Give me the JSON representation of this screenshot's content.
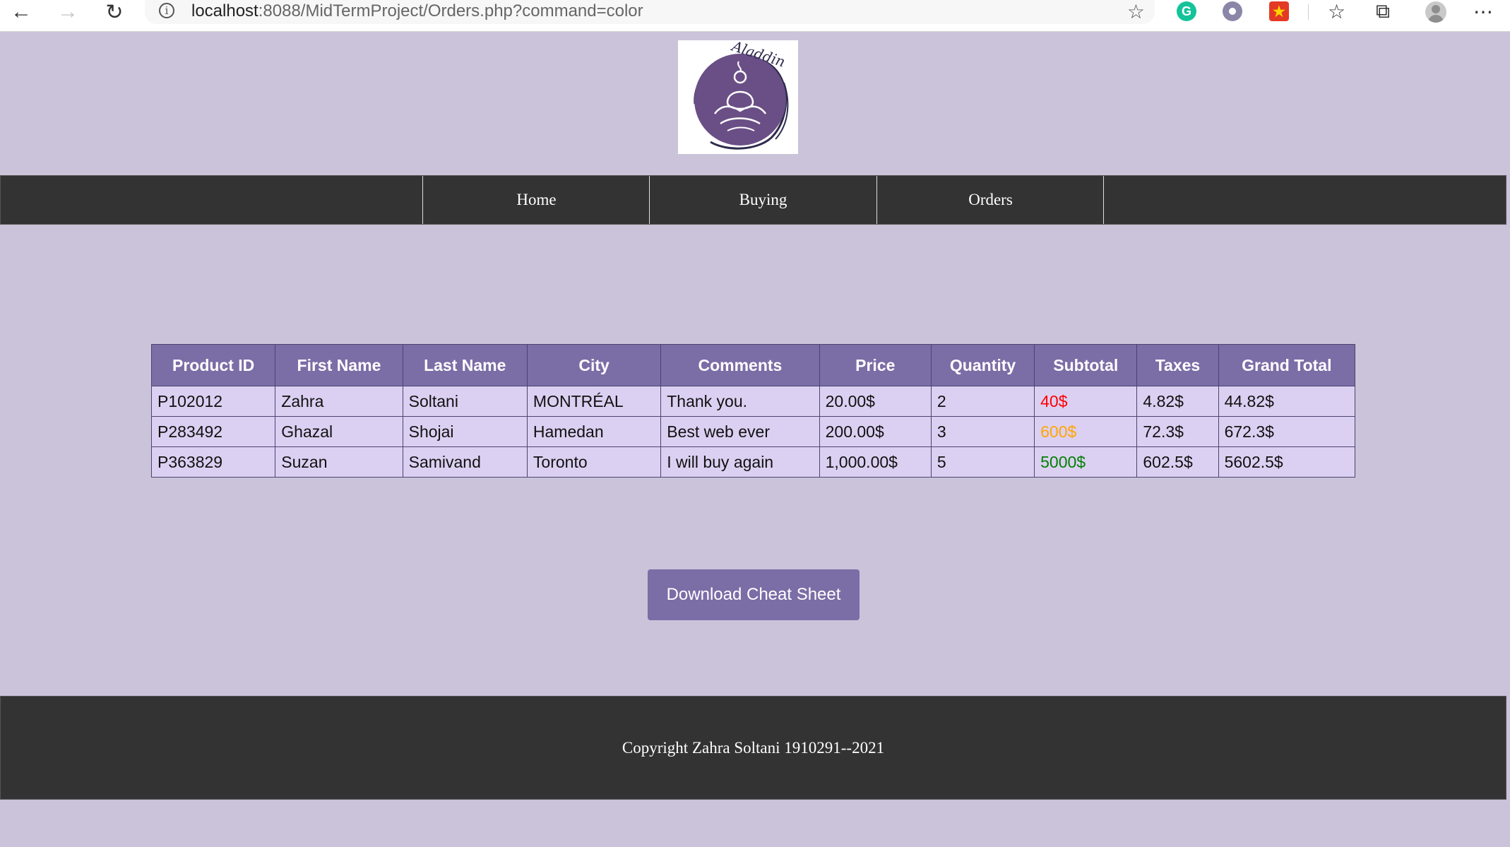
{
  "browser": {
    "url_host": "localhost",
    "url_rest": ":8088/MidTermProject/Orders.php?command=color",
    "info_icon": "info-icon",
    "extensions": [
      "grammarly-icon",
      "extension-circle-icon",
      "extension-star-icon"
    ]
  },
  "logo": {
    "script_text": "Aladdin",
    "colors": {
      "circle": "#6a4f86",
      "lines": "#ffffff",
      "brush": "#2e2b4d"
    }
  },
  "nav": {
    "items": [
      "Home",
      "Buying",
      "Orders"
    ]
  },
  "table": {
    "headers": [
      "Product ID",
      "First Name",
      "Last Name",
      "City",
      "Comments",
      "Price",
      "Quantity",
      "Subtotal",
      "Taxes",
      "Grand Total"
    ],
    "rows": [
      [
        "P102012",
        "Zahra",
        "Soltani",
        "MONTRÉAL",
        "Thank you.",
        "20.00$",
        "2",
        "40$",
        "4.82$",
        "44.82$"
      ],
      [
        "P283492",
        "Ghazal",
        "Shojai",
        "Hamedan",
        "Best web ever",
        "200.00$",
        "3",
        "600$",
        "72.3$",
        "672.3$"
      ],
      [
        "P363829",
        "Suzan",
        "Samivand",
        "Toronto",
        "I will buy again",
        "1,000.00$",
        "5",
        "5000$",
        "602.5$",
        "5602.5$"
      ]
    ],
    "subtotal_colors": [
      "#ff0000",
      "#ffa500",
      "#008000"
    ]
  },
  "download_button": {
    "label": "Download Cheat Sheet"
  },
  "footer": {
    "text": "Copyright Zahra Soltani 1910291--2021"
  },
  "colors": {
    "page_bg": "#cbc3d9",
    "bar_bg": "#333333",
    "accent": "#7b6da6",
    "row_bg": "#dcd0f2"
  }
}
